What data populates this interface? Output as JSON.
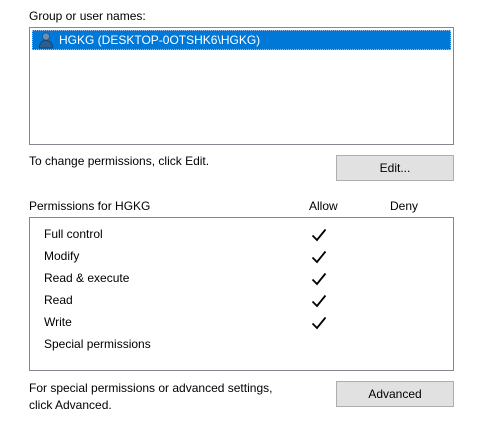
{
  "group_label": "Group or user names:",
  "users": [
    {
      "name": "HGKG (DESKTOP-0OTSHK6\\HGKG)",
      "icon": "user-icon",
      "selected": true
    }
  ],
  "edit_hint": "To change permissions, click Edit.",
  "edit_button": "Edit...",
  "permissions_header": {
    "title": "Permissions for HGKG",
    "allow": "Allow",
    "deny": "Deny"
  },
  "permissions": [
    {
      "name": "Full control",
      "allow": true,
      "deny": false
    },
    {
      "name": "Modify",
      "allow": true,
      "deny": false
    },
    {
      "name": "Read & execute",
      "allow": true,
      "deny": false
    },
    {
      "name": "Read",
      "allow": true,
      "deny": false
    },
    {
      "name": "Write",
      "allow": true,
      "deny": false
    },
    {
      "name": "Special permissions",
      "allow": false,
      "deny": false
    }
  ],
  "advanced_hint": {
    "line1": "For special permissions or advanced settings,",
    "line2": "click Advanced."
  },
  "advanced_button": "Advanced",
  "colors": {
    "selection": "#0078d7",
    "button_bg": "#e1e1e1",
    "border": "#828790"
  }
}
